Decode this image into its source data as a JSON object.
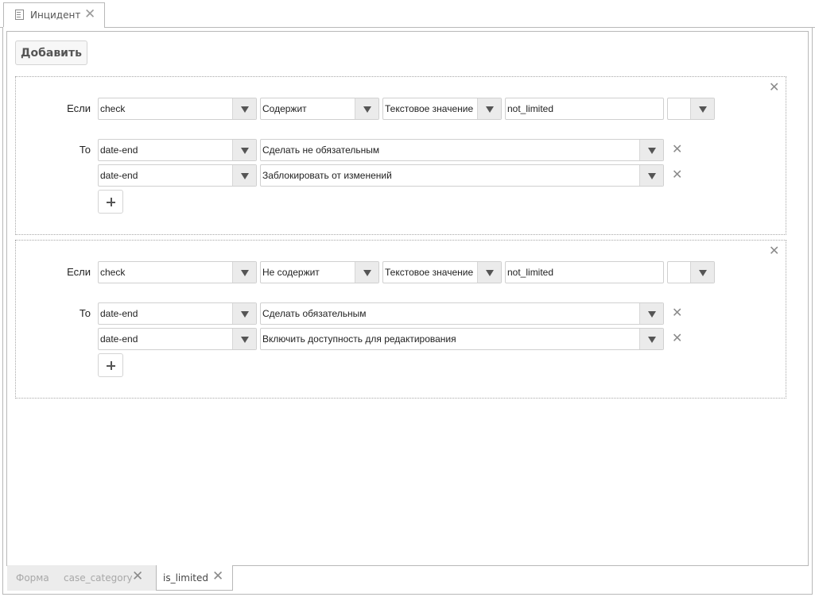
{
  "window_tab": {
    "title": "Инцидент"
  },
  "toolbar": {
    "add_label": "Добавить"
  },
  "rules": [
    {
      "if_label": "Если",
      "condition": {
        "field": "check",
        "operator": "Содержит",
        "value_type": "Текстовое значение",
        "value": "not_limited",
        "extra": ""
      },
      "then_label": "То",
      "actions": [
        {
          "field": "date-end",
          "action": "Сделать не обязательным"
        },
        {
          "field": "date-end",
          "action": "Заблокировать от изменений"
        }
      ]
    },
    {
      "if_label": "Если",
      "condition": {
        "field": "check",
        "operator": "Не содержит",
        "value_type": "Текстовое значение",
        "value": "not_limited",
        "extra": ""
      },
      "then_label": "То",
      "actions": [
        {
          "field": "date-end",
          "action": "Сделать обязательным"
        },
        {
          "field": "date-end",
          "action": "Включить доступность для редактирования"
        }
      ]
    }
  ],
  "bottom_tabs": [
    {
      "label": "Форма",
      "active": false
    },
    {
      "label": "case_category",
      "active": false
    },
    {
      "label": "is_limited",
      "active": true
    }
  ],
  "icons": {
    "tab": "document-icon",
    "close": "close-icon",
    "dropdown": "triangle-down-icon",
    "add": "plus-icon"
  }
}
